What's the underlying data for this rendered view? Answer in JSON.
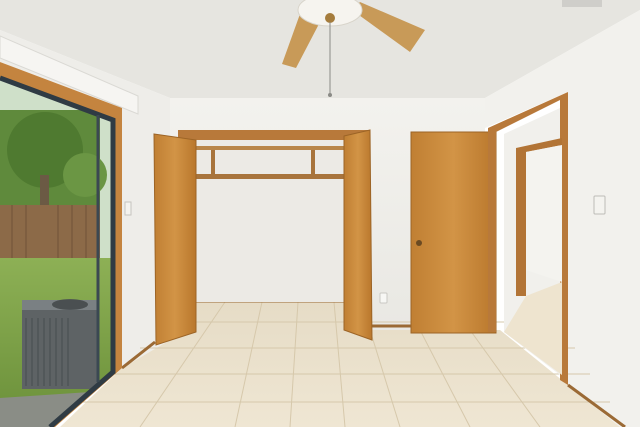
{
  "scene": {
    "kind": "interior-photo",
    "subject": "empty bedroom",
    "features": [
      "ceiling-fan",
      "open-closet",
      "sliding-glass-door",
      "interior-door",
      "hallway",
      "tile-floor",
      "ac-unit-outside"
    ]
  },
  "palette": {
    "ceiling": "#e8e7e2",
    "wall": "#f1f0ec",
    "wall_shadow": "#e4e3df",
    "wood": "#c98a3c",
    "wood_dark": "#a86a26",
    "tile": "#ece2cd",
    "grout": "#d9ccb0",
    "glass_frame": "#2e3a44",
    "grass": "#7fa24a",
    "fence": "#8a6a4a"
  },
  "icons": {
    "fan": "ceiling-fan-icon",
    "outlet": "outlet-icon",
    "light_switch": "light-switch-icon",
    "door_knob": "door-knob-icon",
    "vent": "air-vent-icon"
  }
}
